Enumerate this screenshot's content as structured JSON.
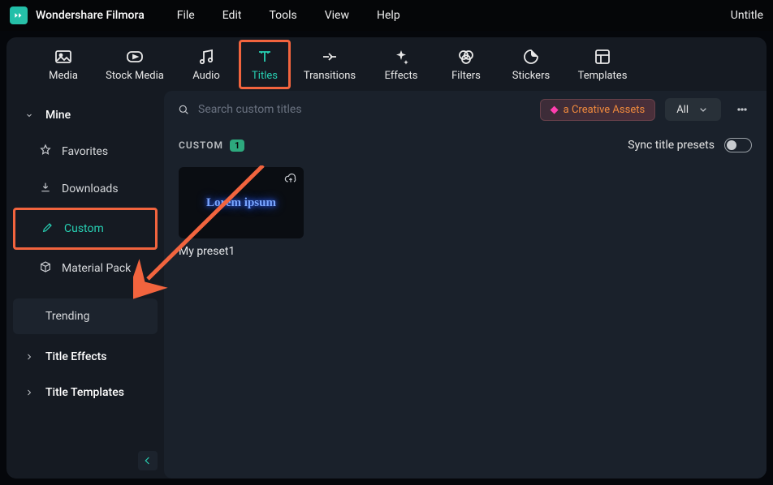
{
  "app": {
    "name": "Wondershare Filmora",
    "doc": "Untitle"
  },
  "menu": [
    "File",
    "Edit",
    "Tools",
    "View",
    "Help"
  ],
  "tabs": [
    {
      "id": "media",
      "label": "Media"
    },
    {
      "id": "stock",
      "label": "Stock Media"
    },
    {
      "id": "audio",
      "label": "Audio"
    },
    {
      "id": "titles",
      "label": "Titles"
    },
    {
      "id": "transitions",
      "label": "Transitions"
    },
    {
      "id": "effects",
      "label": "Effects"
    },
    {
      "id": "filters",
      "label": "Filters"
    },
    {
      "id": "stickers",
      "label": "Stickers"
    },
    {
      "id": "templates",
      "label": "Templates"
    }
  ],
  "sidebar": {
    "group_label": "Mine",
    "items": [
      {
        "label": "Favorites"
      },
      {
        "label": "Downloads"
      },
      {
        "label": "Custom"
      },
      {
        "label": "Material Pack"
      }
    ],
    "trending": "Trending",
    "title_effects": "Title Effects",
    "title_templates": "Title Templates"
  },
  "search": {
    "placeholder": "Search custom titles"
  },
  "actions": {
    "creative": "a Creative Assets",
    "filter": "All"
  },
  "subhead": {
    "label": "CUSTOM",
    "count": "1",
    "sync": "Sync title presets"
  },
  "presets": [
    {
      "name": "My preset1",
      "preview": "Lorem ipsum"
    }
  ]
}
